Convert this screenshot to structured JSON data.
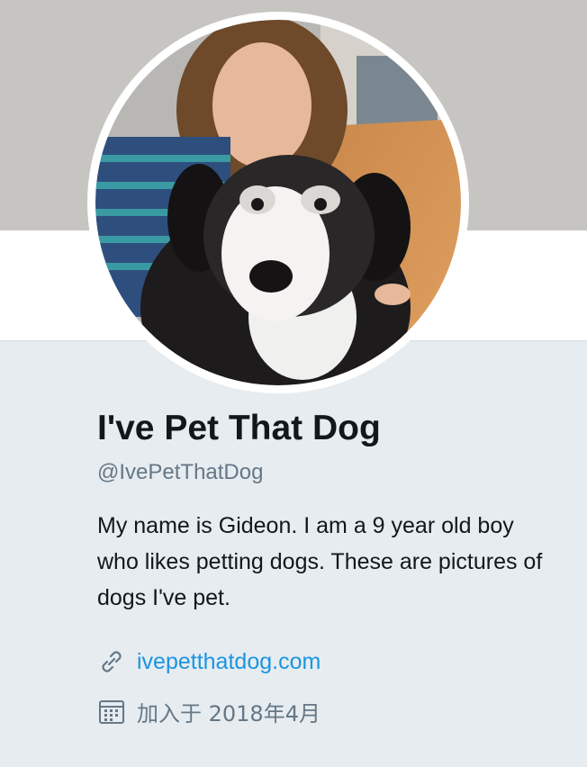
{
  "profile": {
    "display_name": "I've Pet That Dog",
    "handle": "@IvePetThatDog",
    "bio": "My name is Gideon. I am a 9 year old boy who likes petting dogs. These are pictures of dogs I've pet.",
    "website": "ivepetthatdog.com",
    "joined": "加入于 2018年4月"
  },
  "icons": {
    "website": "link-icon",
    "joined": "calendar-icon"
  },
  "colors": {
    "link": "#1b95e0",
    "secondary_text": "#657786",
    "page_background": "#e6ecf0"
  }
}
